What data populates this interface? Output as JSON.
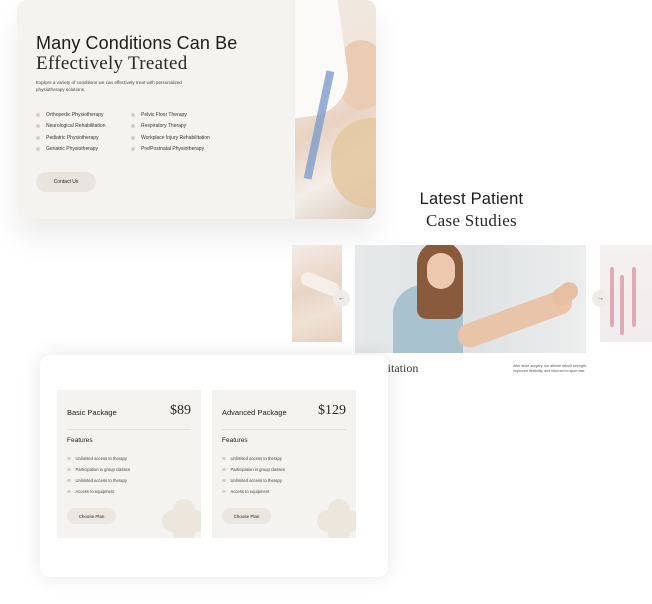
{
  "conditions": {
    "title": "Many Conditions Can Be",
    "subtitle": "Effectively Treated",
    "description": "Explore a variety of conditions we can effectively treat with personalized physiotherapy solutions.",
    "column1": [
      "Orthopedic Physiotherapy",
      "Neurological Rehabilitation",
      "Pediatric Physiotherapy",
      "Geriatric Physiotherapy"
    ],
    "column2": [
      "Pelvic Floor Therapy",
      "Respiratory Therapy",
      "Workplace Injury Rehabilitation",
      "Pre/Postnatal Physiotherapy"
    ],
    "contact_label": "Contact Us"
  },
  "case_studies": {
    "title": "Latest Patient",
    "subtitle": "Case Studies",
    "prev_icon": "←",
    "next_icon": "→",
    "caption_left": "ilitation",
    "caption_right": "After knee surgery, our athlete rebuilt strength, improved flexibility, and returned to sport fast."
  },
  "pricing": {
    "plans": [
      {
        "name": "Basic Package",
        "price": "$89",
        "features_title": "Features",
        "features": [
          "Unlimited access to therapy",
          "Participation in group classes",
          "Unlimited access to therapy",
          "Access to equipment"
        ],
        "button": "Choose Plan"
      },
      {
        "name": "Advanced Package",
        "price": "$129",
        "features_title": "Features",
        "features": [
          "Unlimited access to therapy",
          "Participation in group classes",
          "Unlimited access to therapy",
          "Access to equipment"
        ],
        "button": "Choose Plan"
      }
    ]
  },
  "colors": {
    "card_bg": "#f5f3ef",
    "accent_dot": "#d8cfc4",
    "button_bg": "#e9e4dd"
  }
}
